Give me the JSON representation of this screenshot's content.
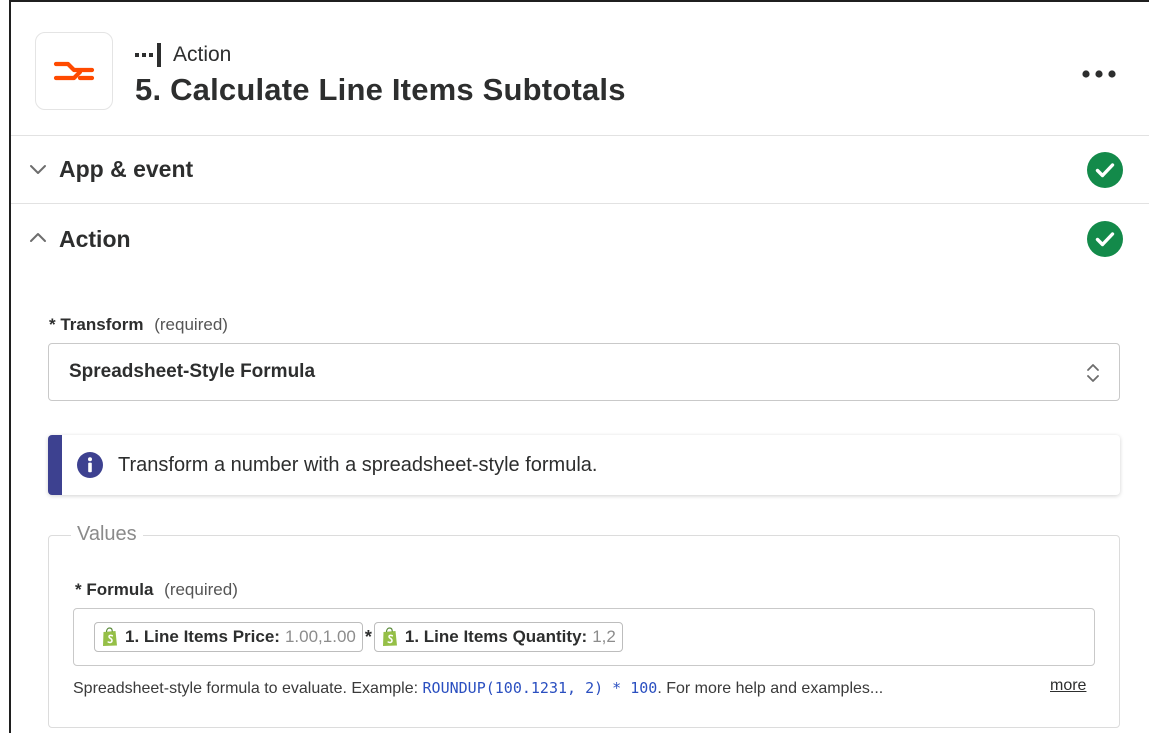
{
  "header": {
    "step_type": "Action",
    "step_title": "5. Calculate Line Items Subtotals",
    "app_icon": "formatter-icon",
    "brand_color": "#ff4a00",
    "more_icon": "more-horizontal-icon"
  },
  "sections": {
    "app_event": {
      "title": "App & event",
      "expanded": false,
      "status": "complete"
    },
    "action": {
      "title": "Action",
      "expanded": true,
      "status": "complete"
    }
  },
  "status_color": "#138a4a",
  "form": {
    "transform": {
      "asterisk": "*",
      "label": "Transform",
      "required": "(required)",
      "value": "Spreadsheet-Style Formula"
    },
    "info": {
      "text": "Transform a number with a spreadsheet-style formula.",
      "accent_color": "#3d4190"
    },
    "values_legend": "Values",
    "formula": {
      "asterisk": "*",
      "label": "Formula",
      "required": "(required)",
      "pill1_label": "1. Line Items Price:",
      "pill1_value": "1.00,1.00",
      "operator": "*",
      "pill2_label": "1. Line Items Quantity:",
      "pill2_value": "1,2",
      "help_prefix": "Spreadsheet-style formula to evaluate. Example:",
      "help_code": "ROUNDUP(100.1231, 2) * 100",
      "help_suffix": ". For more help and examples...",
      "more_link": "more"
    }
  }
}
